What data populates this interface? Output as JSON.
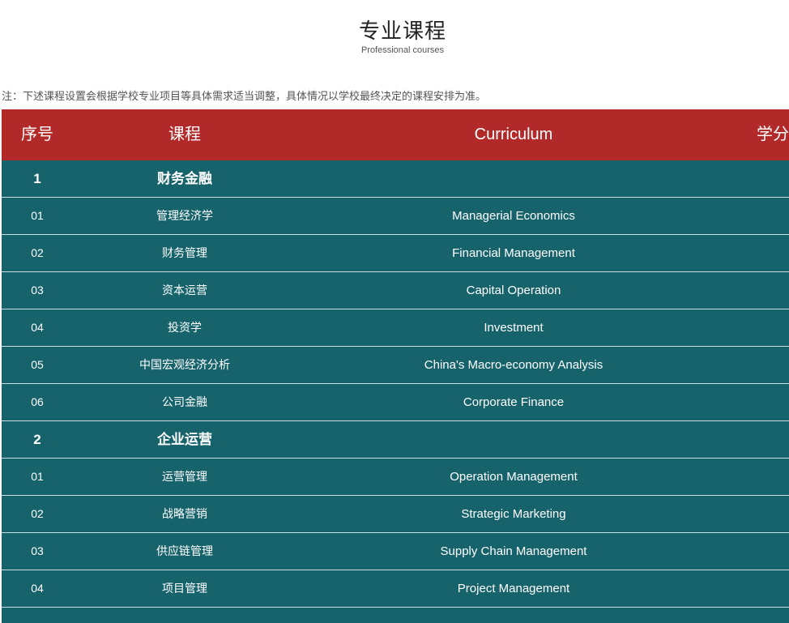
{
  "page": {
    "title": "专业课程",
    "subtitle": "Professional courses",
    "note": "注：下述课程设置会根据学校专业项目等具体需求适当调整，具体情况以学校最终决定的课程安排为准。"
  },
  "colors": {
    "header_bg": "#b12a29",
    "row_bg": "#17636c",
    "text_light": "#ffffff"
  },
  "table": {
    "headers": {
      "seq": "序号",
      "course": "课程",
      "curriculum": "Curriculum",
      "credit": "学分"
    },
    "rows": [
      {
        "seq": "1",
        "course": "财务金融",
        "curriculum": ""
      },
      {
        "seq": "01",
        "course": "管理经济学",
        "curriculum": "Managerial Economics"
      },
      {
        "seq": "02",
        "course": "财务管理",
        "curriculum": "Financial Management"
      },
      {
        "seq": "03",
        "course": "资本运营",
        "curriculum": "Capital Operation"
      },
      {
        "seq": "04",
        "course": "投资学",
        "curriculum": "Investment"
      },
      {
        "seq": "05",
        "course": "中国宏观经济分析",
        "curriculum": "China's Macro-economy Analysis"
      },
      {
        "seq": "06",
        "course": "公司金融",
        "curriculum": "Corporate Finance"
      },
      {
        "seq": "2",
        "course": "企业运营",
        "curriculum": ""
      },
      {
        "seq": "01",
        "course": "运营管理",
        "curriculum": "Operation Management"
      },
      {
        "seq": "02",
        "course": "战略营销",
        "curriculum": "Strategic Marketing"
      },
      {
        "seq": "03",
        "course": "供应链管理",
        "curriculum": "Supply Chain Management"
      },
      {
        "seq": "04",
        "course": "项目管理",
        "curriculum": "Project Management"
      }
    ]
  }
}
